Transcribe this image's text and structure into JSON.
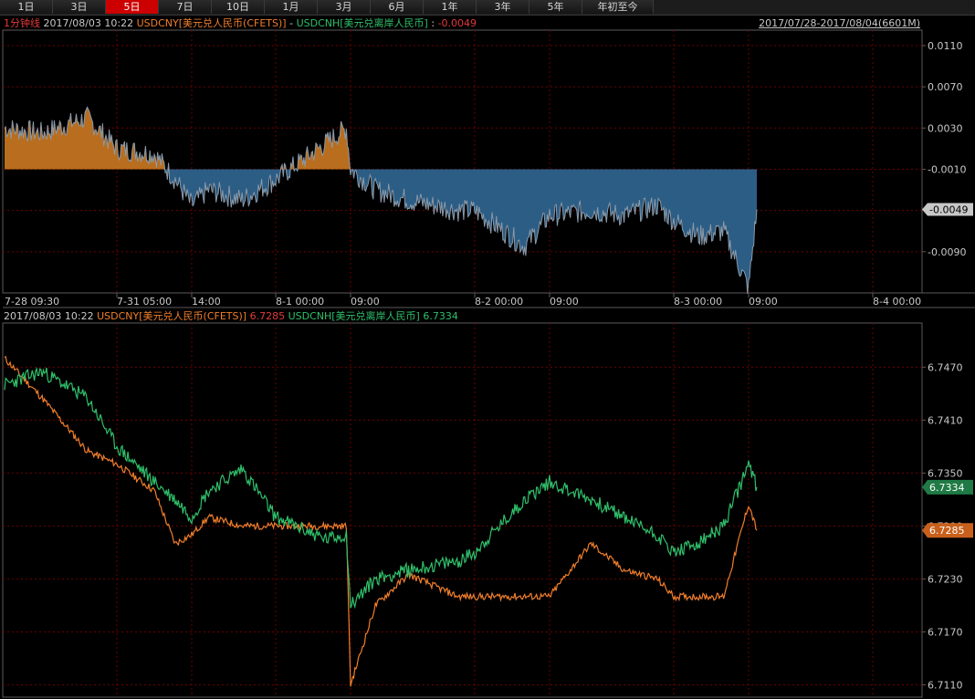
{
  "tabs": [
    "1日",
    "3日",
    "5日",
    "7日",
    "10日",
    "1月",
    "3月",
    "6月",
    "1年",
    "3年",
    "5年",
    "年初至今"
  ],
  "active_tab": "5日",
  "top_header": {
    "period": "1分钟线",
    "date": "2017/08/03 10:22",
    "s1": "USDCNY[美元兑人民币(CFETS)]",
    "sep": "-",
    "s2": "USDCNH[美元兑离岸人民币]",
    "colon": ":",
    "value": "-0.0049"
  },
  "date_range": "2017/07/28-2017/08/04(6601M)",
  "bottom_header": {
    "date": "2017/08/03 10:22",
    "s1": "USDCNY[美元兑人民币(CFETS)]",
    "v1": "6.7285",
    "s2": "USDCNH[美元兑离岸人民币]",
    "v2": "6.7334"
  },
  "time_axis": [
    "7-28 09:30",
    "7-31 05:00",
    "14:00",
    "8-1 00:00",
    "09:00",
    "8-2 00:00",
    "09:00",
    "8-3 00:00",
    "09:00",
    "8-4 00:00"
  ],
  "colors": {
    "usdcny": "#f07e2c",
    "usdcnh": "#2fbf6a",
    "spread_pos": "#b86e1e",
    "spread_neg": "#2c5d85",
    "spread_line": "#8a9aaa",
    "grid": "#6e0000",
    "axis": "#5a5a5a",
    "text": "#c8c8c8"
  },
  "chart_data": [
    {
      "type": "area",
      "title": "USDCNY[美元兑人民币(CFETS)] - USDCNH[美元兑离岸人民币]",
      "yticks": [
        "0.0110",
        "0.0070",
        "0.0030",
        "-0.0010",
        "-0.0050",
        "-0.0090"
      ],
      "ylim": [
        -0.013,
        0.0125
      ],
      "last_value": "-0.0049",
      "x": [
        "7-28 09:30",
        "7-28 12:00",
        "7-28 15:00",
        "7-31 05:00",
        "7-31 09:30",
        "7-31 12:00",
        "7-31 14:00",
        "7-31 16:00",
        "7-31 20:00",
        "8-1 00:00",
        "8-1 06:00",
        "8-1 08:30",
        "8-1 09:00",
        "8-1 12:00",
        "8-1 16:00",
        "8-1 22:00",
        "8-2 00:00",
        "8-2 06:00",
        "8-2 09:00",
        "8-2 14:00",
        "8-2 18:00",
        "8-2 22:00",
        "8-3 00:00",
        "8-3 03:00",
        "8-3 06:00",
        "8-3 09:00",
        "8-3 10:22"
      ],
      "series": [
        {
          "values": [
            0.003,
            0.0025,
            0.004,
            0.001,
            0.0005,
            -0.002,
            -0.0045,
            -0.003,
            -0.004,
            -0.002,
            0.0015,
            0.003,
            -0.001,
            -0.003,
            -0.004,
            -0.005,
            -0.005,
            -0.0085,
            -0.0055,
            -0.005,
            -0.0055,
            -0.0045,
            -0.006,
            -0.0075,
            -0.007,
            -0.0125,
            -0.0049
          ]
        }
      ]
    },
    {
      "type": "line",
      "yticks": [
        "6.7470",
        "6.7410",
        "6.7350",
        "6.7290",
        "6.7230",
        "6.7170",
        "6.7110"
      ],
      "ylim": [
        6.7096,
        6.752
      ],
      "x": [
        "7-28 09:30",
        "7-28 12:00",
        "7-28 15:00",
        "7-31 05:00",
        "7-31 09:30",
        "7-31 12:00",
        "7-31 14:00",
        "7-31 16:00",
        "7-31 20:00",
        "8-1 00:00",
        "8-1 06:00",
        "8-1 08:30",
        "8-1 09:00",
        "8-1 12:00",
        "8-1 16:00",
        "8-1 22:00",
        "8-2 00:00",
        "8-2 06:00",
        "8-2 09:00",
        "8-2 14:00",
        "8-2 18:00",
        "8-2 22:00",
        "8-3 00:00",
        "8-3 03:00",
        "8-3 06:00",
        "8-3 09:00",
        "8-3 10:22"
      ],
      "series": [
        {
          "name": "USDCNY[美元兑人民币(CFETS)]",
          "last_value": "6.7285",
          "values": [
            6.748,
            6.7435,
            6.7375,
            6.736,
            6.733,
            6.727,
            6.728,
            6.73,
            6.729,
            6.729,
            6.729,
            6.729,
            6.711,
            6.72,
            6.7235,
            6.721,
            6.721,
            6.721,
            6.721,
            6.727,
            6.724,
            6.723,
            6.721,
            6.721,
            6.721,
            6.7315,
            6.7285
          ]
        },
        {
          "name": "USDCNH[美元兑离岸人民币]",
          "last_value": "6.7334",
          "values": [
            6.745,
            6.7465,
            6.7435,
            6.738,
            6.734,
            6.732,
            6.73,
            6.733,
            6.7355,
            6.73,
            6.7275,
            6.728,
            6.72,
            6.723,
            6.724,
            6.725,
            6.726,
            6.732,
            6.734,
            6.732,
            6.73,
            6.728,
            6.726,
            6.727,
            6.729,
            6.736,
            6.7334
          ]
        }
      ]
    }
  ]
}
